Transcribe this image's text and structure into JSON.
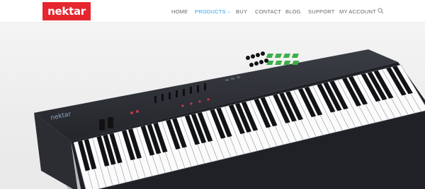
{
  "brand": {
    "logo_text": "nektar",
    "color": "#e5262e"
  },
  "nav": {
    "items": [
      {
        "label": "HOME",
        "active": false
      },
      {
        "label": "PRODUCTS",
        "active": true,
        "has_dropdown": true
      },
      {
        "label": "BUY",
        "active": false
      },
      {
        "label": "CONTACT",
        "active": false
      },
      {
        "label": "BLOG",
        "active": false
      },
      {
        "label": "SUPPORT",
        "active": false
      },
      {
        "label": "MY ACCOUNT",
        "active": false
      }
    ],
    "active_color": "#2ea3f2",
    "search_icon": "search-icon"
  },
  "hero": {
    "image": "keyboard-controller",
    "keyboard_brand": "nektar"
  }
}
